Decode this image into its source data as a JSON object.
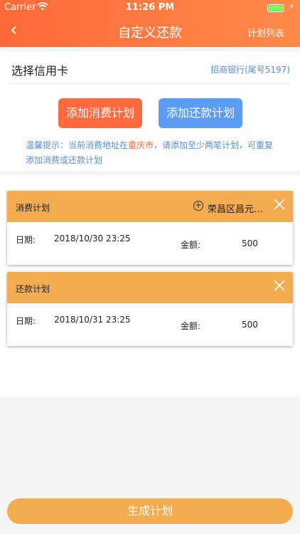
{
  "status": {
    "carrier": "Carrier",
    "time": "11:26 PM"
  },
  "nav": {
    "back": "‹",
    "title": "自定义还款",
    "plan_list": "计划列表"
  },
  "card": {
    "label": "选择信用卡",
    "bank": "招商银行(尾号5197)"
  },
  "buttons": {
    "consume": "添加消费计划",
    "repay": "添加还款计划"
  },
  "tip": {
    "prefix": "温馨提示：当前消费地址在",
    "city": "重庆市",
    "suffix": "，请添加至少两笔计划，可重复添加消费或还款计划"
  },
  "plans": [
    {
      "name": "消费计划",
      "address": "荣昌区昌元街道",
      "date_label": "日期:",
      "date": "2018/10/30 23:25",
      "amount_label": "金额:",
      "amount": "500"
    },
    {
      "name": "还款计划",
      "date_label": "日期:",
      "date": "2018/10/31 23:25",
      "amount_label": "金额:",
      "amount": "500"
    }
  ],
  "generate": "生成计划",
  "colors": {
    "header": "#ff6a3a",
    "accent": "#f3ac50",
    "consume": "#ff6a3f",
    "repay": "#5d9cf5",
    "link": "#5a8cd8"
  }
}
